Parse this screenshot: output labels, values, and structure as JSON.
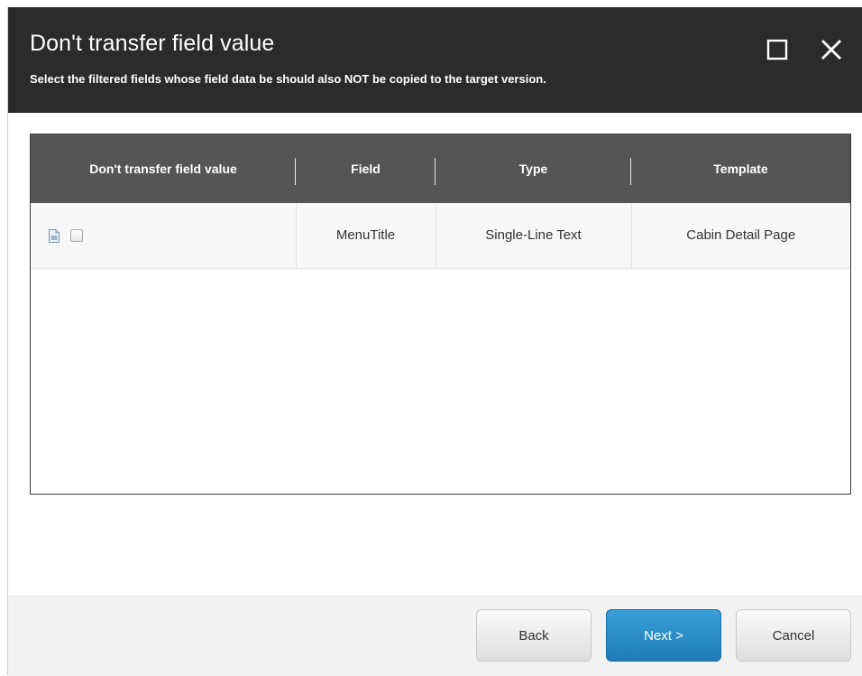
{
  "dialog": {
    "title": "Don't transfer field value",
    "subtitle": "Select the filtered fields whose field data be should also NOT be copied to the target version.",
    "maximize_icon": "maximize-icon",
    "close_icon": "close-icon"
  },
  "table": {
    "columns": [
      "Don't transfer field value",
      "Field",
      "Type",
      "Template"
    ],
    "rows": [
      {
        "icon": "document-icon",
        "checked": false,
        "field": "MenuTitle",
        "type": "Single-Line Text",
        "template": "Cabin Detail Page"
      }
    ]
  },
  "footer": {
    "back_label": "Back",
    "next_label": "Next >",
    "cancel_label": "Cancel"
  },
  "colors": {
    "titlebar": "#2b2b2b",
    "table_header": "#555555",
    "primary_button": "#2a8cc7"
  }
}
